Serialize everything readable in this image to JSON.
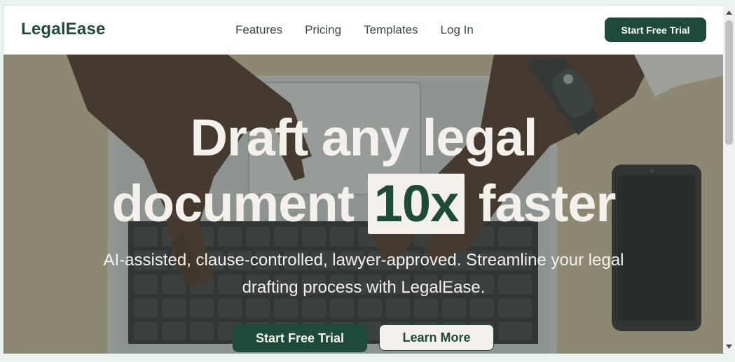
{
  "header": {
    "brand": "LegalEase",
    "nav": [
      {
        "label": "Features"
      },
      {
        "label": "Pricing"
      },
      {
        "label": "Templates"
      },
      {
        "label": "Log In"
      }
    ],
    "cta_label": "Start Free Trial"
  },
  "hero": {
    "title_line1": "Draft any legal",
    "title_line2_before": "document",
    "title_highlight": "10x",
    "title_line2_after": "faster",
    "subtitle": "AI-assisted, clause-controlled, lawyer-approved. Streamline your legal drafting process with LegalEase.",
    "primary_button": "Start Free Trial",
    "secondary_button": "Learn More"
  },
  "colors": {
    "brand_green": "#1d4a39",
    "cream": "#f4f1ec"
  },
  "icons": {
    "scroll_up": "triangle-up-icon",
    "scroll_down": "triangle-down-icon"
  }
}
